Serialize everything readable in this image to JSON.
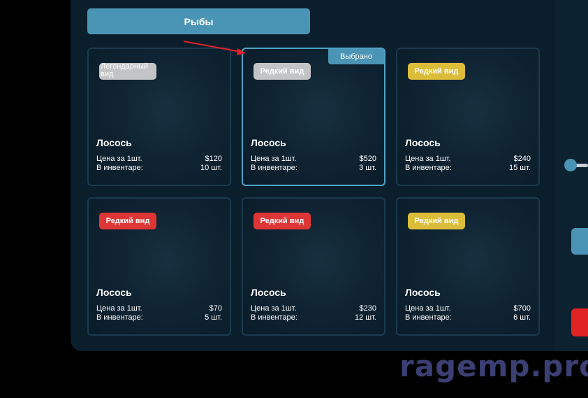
{
  "category": {
    "label": "Рыбы"
  },
  "labels": {
    "price": "Цена за 1шт.",
    "inventory": "В инвентаре:",
    "selected": "Выбрано"
  },
  "colors": {
    "accent": "#4a94b5",
    "legendary": "#c3c4c5",
    "rare_red": "#de3535",
    "rare_yellow": "#dcbd3a"
  },
  "cards": [
    {
      "badge": "Легендарный вид",
      "badge_color": "gray",
      "name": "Лосось",
      "price": "$120",
      "qty": "10 шт.",
      "selected": false
    },
    {
      "badge": "Редкий вид",
      "badge_color": "gray",
      "name": "Лосось",
      "price": "$520",
      "qty": "3 шт.",
      "selected": true
    },
    {
      "badge": "Редкий вид",
      "badge_color": "yellow",
      "name": "Лосось",
      "price": "$240",
      "qty": "15 шт.",
      "selected": false
    },
    {
      "badge": "Редкий вид",
      "badge_color": "red",
      "name": "Лосось",
      "price": "$70",
      "qty": "5 шт.",
      "selected": false
    },
    {
      "badge": "Редкий вид",
      "badge_color": "red",
      "name": "Лосось",
      "price": "$230",
      "qty": "12 шт.",
      "selected": false
    },
    {
      "badge": "Редкий вид",
      "badge_color": "yellow",
      "name": "Лосось",
      "price": "$700",
      "qty": "6 шт.",
      "selected": false
    }
  ],
  "watermark": "ragemp.pro"
}
